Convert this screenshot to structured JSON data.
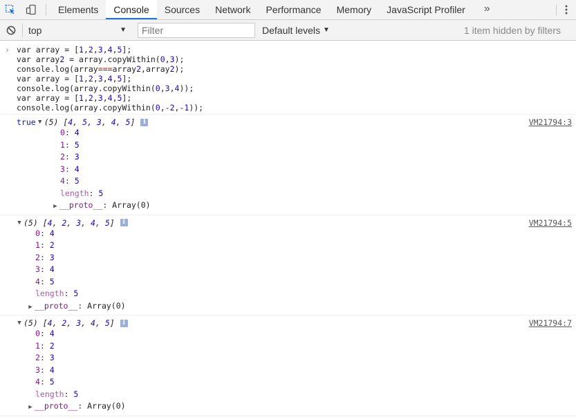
{
  "tabs": [
    {
      "label": "Elements",
      "active": false
    },
    {
      "label": "Console",
      "active": true
    },
    {
      "label": "Sources",
      "active": false
    },
    {
      "label": "Network",
      "active": false
    },
    {
      "label": "Performance",
      "active": false
    },
    {
      "label": "Memory",
      "active": false
    },
    {
      "label": "JavaScript Profiler",
      "active": false
    }
  ],
  "tabbar": {
    "more": "»",
    "icons": [
      "inspect-element-icon",
      "device-toolbar-icon",
      "kebab-menu-icon"
    ]
  },
  "toolbar": {
    "context": "top",
    "filter_placeholder": "Filter",
    "filter_value": "",
    "levels": "Default levels",
    "hidden_note": "1 item hidden by filters"
  },
  "colors": {
    "accent": "#1a73e8",
    "number": "#1c00cf",
    "key": "#881391",
    "keyword": "#0d22aa",
    "operator": "#c80000"
  },
  "input_lines": [
    "var array = [1,2,3,4,5];",
    "var array2 = array.copyWithin(0,3);",
    "console.log(array===array2,array2);",
    "var array = [1,2,3,4,5];",
    "console.log(array.copyWithin(0,3,4));",
    "var array = [1,2,3,4,5];",
    "console.log(array.copyWithin(0,-2,-1));"
  ],
  "messages": [
    {
      "prefix": "true",
      "preview_len": "(5)",
      "preview_items": [
        "4",
        "5",
        "3",
        "4",
        "5"
      ],
      "source": "VM21794:3",
      "entries": [
        {
          "key": "0",
          "value": "4"
        },
        {
          "key": "1",
          "value": "5"
        },
        {
          "key": "2",
          "value": "3"
        },
        {
          "key": "3",
          "value": "4"
        },
        {
          "key": "4",
          "value": "5"
        }
      ],
      "length_key": "length",
      "length_value": "5",
      "proto_key": "__proto__",
      "proto_value": "Array(0)"
    },
    {
      "prefix": "",
      "preview_len": "(5)",
      "preview_items": [
        "4",
        "2",
        "3",
        "4",
        "5"
      ],
      "source": "VM21794:5",
      "entries": [
        {
          "key": "0",
          "value": "4"
        },
        {
          "key": "1",
          "value": "2"
        },
        {
          "key": "2",
          "value": "3"
        },
        {
          "key": "3",
          "value": "4"
        },
        {
          "key": "4",
          "value": "5"
        }
      ],
      "length_key": "length",
      "length_value": "5",
      "proto_key": "__proto__",
      "proto_value": "Array(0)"
    },
    {
      "prefix": "",
      "preview_len": "(5)",
      "preview_items": [
        "4",
        "2",
        "3",
        "4",
        "5"
      ],
      "source": "VM21794:7",
      "entries": [
        {
          "key": "0",
          "value": "4"
        },
        {
          "key": "1",
          "value": "2"
        },
        {
          "key": "2",
          "value": "3"
        },
        {
          "key": "3",
          "value": "4"
        },
        {
          "key": "4",
          "value": "5"
        }
      ],
      "length_key": "length",
      "length_value": "5",
      "proto_key": "__proto__",
      "proto_value": "Array(0)"
    }
  ]
}
